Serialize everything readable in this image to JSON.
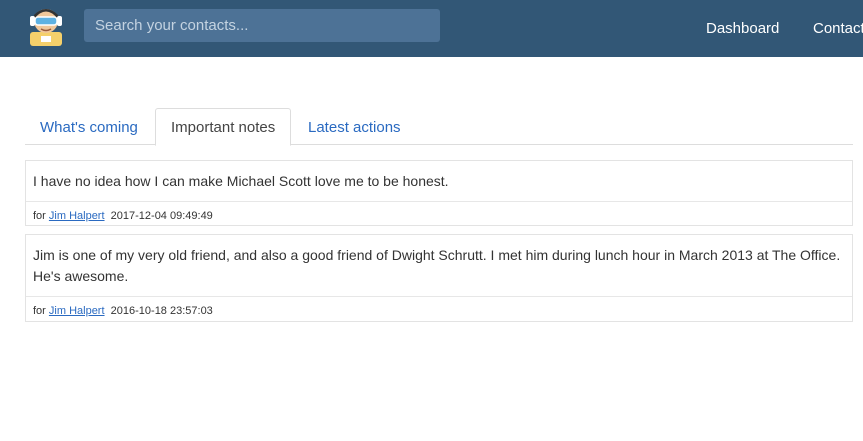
{
  "header": {
    "search_placeholder": "Search your contacts...",
    "nav": [
      "Dashboard",
      "Contacts"
    ]
  },
  "tabs": [
    {
      "label": "What's coming",
      "active": false
    },
    {
      "label": "Important notes",
      "active": true
    },
    {
      "label": "Latest actions",
      "active": false
    }
  ],
  "notes": [
    {
      "text": "I have no idea how I can make Michael Scott love me to be honest.",
      "for_label": "for",
      "contact": "Jim Halpert",
      "timestamp": "2017-12-04 09:49:49"
    },
    {
      "text": "Jim is one of my very old friend, and also a good friend of Dwight Schrutt. I met him during lunch hour in March 2013 at The Office. He's awesome.",
      "for_label": "for",
      "contact": "Jim Halpert",
      "timestamp": "2016-10-18 23:57:03"
    }
  ],
  "colors": {
    "header_bg": "#325776",
    "search_bg": "#4d7296",
    "link": "#2a6ac1"
  }
}
